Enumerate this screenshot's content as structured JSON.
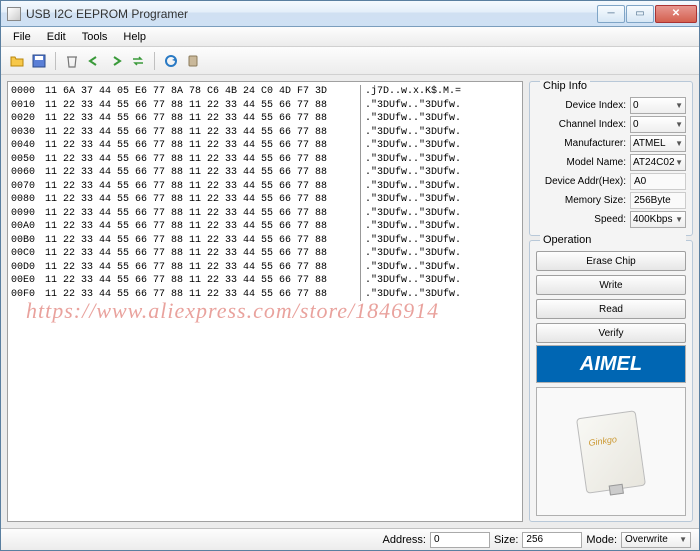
{
  "window": {
    "title": "USB I2C EEPROM Programer"
  },
  "menu": {
    "file": "File",
    "edit": "Edit",
    "tools": "Tools",
    "help": "Help"
  },
  "hex": {
    "rows": [
      {
        "off": "0000",
        "b": "11 6A 37 44 05 E6 77 8A 78 C6 4B 24 C0 4D F7 3D",
        "a": ".j7D..w.x.K$.M.="
      },
      {
        "off": "0010",
        "b": "11 22 33 44 55 66 77 88 11 22 33 44 55 66 77 88",
        "a": ".\"3DUfw..\"3DUfw."
      },
      {
        "off": "0020",
        "b": "11 22 33 44 55 66 77 88 11 22 33 44 55 66 77 88",
        "a": ".\"3DUfw..\"3DUfw."
      },
      {
        "off": "0030",
        "b": "11 22 33 44 55 66 77 88 11 22 33 44 55 66 77 88",
        "a": ".\"3DUfw..\"3DUfw."
      },
      {
        "off": "0040",
        "b": "11 22 33 44 55 66 77 88 11 22 33 44 55 66 77 88",
        "a": ".\"3DUfw..\"3DUfw."
      },
      {
        "off": "0050",
        "b": "11 22 33 44 55 66 77 88 11 22 33 44 55 66 77 88",
        "a": ".\"3DUfw..\"3DUfw."
      },
      {
        "off": "0060",
        "b": "11 22 33 44 55 66 77 88 11 22 33 44 55 66 77 88",
        "a": ".\"3DUfw..\"3DUfw."
      },
      {
        "off": "0070",
        "b": "11 22 33 44 55 66 77 88 11 22 33 44 55 66 77 88",
        "a": ".\"3DUfw..\"3DUfw."
      },
      {
        "off": "0080",
        "b": "11 22 33 44 55 66 77 88 11 22 33 44 55 66 77 88",
        "a": ".\"3DUfw..\"3DUfw."
      },
      {
        "off": "0090",
        "b": "11 22 33 44 55 66 77 88 11 22 33 44 55 66 77 88",
        "a": ".\"3DUfw..\"3DUfw."
      },
      {
        "off": "00A0",
        "b": "11 22 33 44 55 66 77 88 11 22 33 44 55 66 77 88",
        "a": ".\"3DUfw..\"3DUfw."
      },
      {
        "off": "00B0",
        "b": "11 22 33 44 55 66 77 88 11 22 33 44 55 66 77 88",
        "a": ".\"3DUfw..\"3DUfw."
      },
      {
        "off": "00C0",
        "b": "11 22 33 44 55 66 77 88 11 22 33 44 55 66 77 88",
        "a": ".\"3DUfw..\"3DUfw."
      },
      {
        "off": "00D0",
        "b": "11 22 33 44 55 66 77 88 11 22 33 44 55 66 77 88",
        "a": ".\"3DUfw..\"3DUfw."
      },
      {
        "off": "00E0",
        "b": "11 22 33 44 55 66 77 88 11 22 33 44 55 66 77 88",
        "a": ".\"3DUfw..\"3DUfw."
      },
      {
        "off": "00F0",
        "b": "11 22 33 44 55 66 77 88 11 22 33 44 55 66 77 88",
        "a": ".\"3DUfw..\"3DUfw."
      }
    ]
  },
  "chipinfo": {
    "title": "Chip Info",
    "labels": {
      "deviceIndex": "Device Index:",
      "channelIndex": "Channel Index:",
      "manufacturer": "Manufacturer:",
      "modelName": "Model Name:",
      "deviceAddr": "Device Addr(Hex):",
      "memorySize": "Memory Size:",
      "speed": "Speed:"
    },
    "values": {
      "deviceIndex": "0",
      "channelIndex": "0",
      "manufacturer": "ATMEL",
      "modelName": "AT24C02",
      "deviceAddr": "A0",
      "memorySize": "256Byte",
      "speed": "400Kbps"
    }
  },
  "operation": {
    "title": "Operation",
    "erase": "Erase Chip",
    "write": "Write",
    "read": "Read",
    "verify": "Verify"
  },
  "logo": "AIMEL",
  "status": {
    "addressLabel": "Address:",
    "address": "0",
    "sizeLabel": "Size:",
    "size": "256",
    "modeLabel": "Mode:",
    "mode": "Overwrite"
  },
  "watermark": "https://www.aliexpress.com/store/1846914"
}
